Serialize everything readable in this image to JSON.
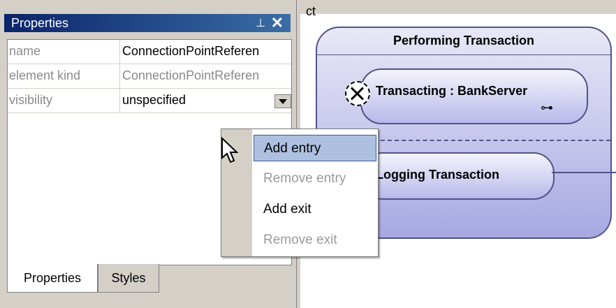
{
  "panel": {
    "title": "Properties",
    "pin_glyph": "⊥",
    "close_glyph": "✕",
    "rows": [
      {
        "key": "name",
        "value": "ConnectionPointReferen"
      },
      {
        "key": "element kind",
        "value": "ConnectionPointReferen"
      },
      {
        "key": "visibility",
        "value": "unspecified"
      }
    ],
    "tabs": [
      "Properties",
      "Styles"
    ]
  },
  "diagram": {
    "fragment_text": "ct",
    "outer_state": "Performing Transaction",
    "state1": "Transacting : BankServer",
    "state1_link": "⊶",
    "state2": "Logging Transaction"
  },
  "menu": {
    "items": [
      "Add entry",
      "Remove entry",
      "Add exit",
      "Remove exit"
    ],
    "highlighted": "Add entry"
  },
  "colors": {
    "titlebar_start": "#0a246a",
    "titlebar_end": "#3a6ea5",
    "state_border": "#52528a",
    "menu_highlight": "#aec0e0"
  }
}
